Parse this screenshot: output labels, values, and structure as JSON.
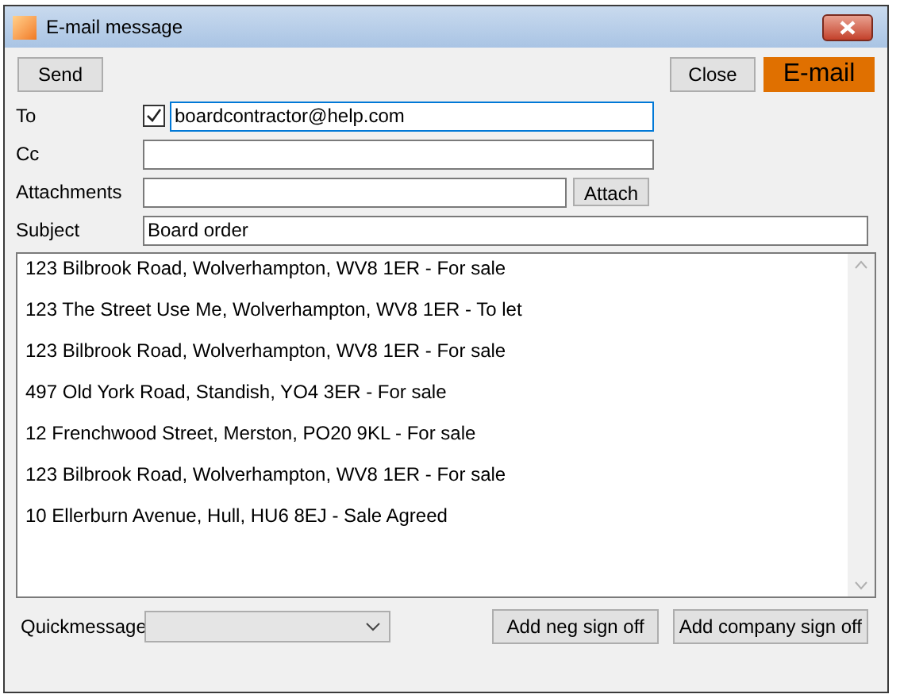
{
  "window": {
    "title": "E-mail message"
  },
  "toolbar": {
    "send": "Send",
    "close": "Close",
    "badge": "E-mail"
  },
  "form": {
    "to_label": "To",
    "to_checked": true,
    "to_value": "boardcontractor@help.com",
    "cc_label": "Cc",
    "attachments_label": "Attachments",
    "attach_button": "Attach",
    "subject_label": "Subject",
    "subject_value": "Board order"
  },
  "message_lines": [
    "123 Bilbrook Road, Wolverhampton, WV8 1ER - For sale",
    "123 The Street Use Me, Wolverhampton, WV8 1ER - To let",
    "123 Bilbrook Road, Wolverhampton, WV8 1ER - For sale",
    "497 Old York Road, Standish, YO4 3ER - For sale",
    "12 Frenchwood Street, Merston, PO20 9KL - For sale",
    "123 Bilbrook Road, Wolverhampton, WV8 1ER - For sale",
    "10 Ellerburn Avenue, Hull, HU6 8EJ - Sale Agreed"
  ],
  "footer": {
    "quickmessage_label": "Quickmessage",
    "neg_button": "Add neg sign off",
    "company_button": "Add company sign off"
  }
}
